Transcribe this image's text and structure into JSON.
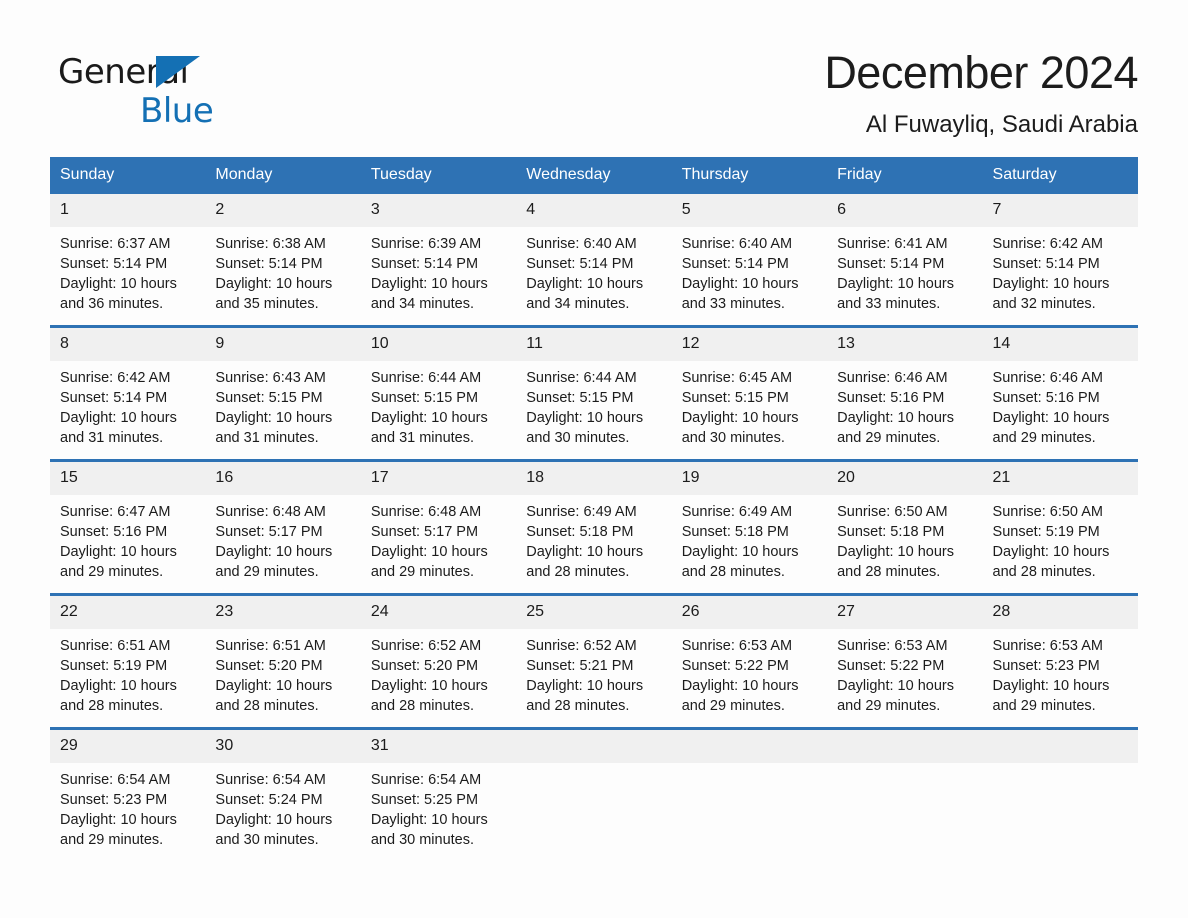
{
  "brand": {
    "name_part1": "General",
    "name_part2": "Blue",
    "flag_icon": "triangle-flag-icon",
    "accent_color": "#1470b4"
  },
  "header": {
    "title": "December 2024",
    "subtitle": "Al Fuwayliq, Saudi Arabia"
  },
  "colors": {
    "header_blue": "#2e72b4",
    "date_band": "#f0f0f0",
    "page_background": "#fdfdfd",
    "text": "#1c1c1c"
  },
  "weekdays": [
    "Sunday",
    "Monday",
    "Tuesday",
    "Wednesday",
    "Thursday",
    "Friday",
    "Saturday"
  ],
  "weeks": [
    [
      {
        "day": "1",
        "sunrise": "Sunrise: 6:37 AM",
        "sunset": "Sunset: 5:14 PM",
        "daylight_line1": "Daylight: 10 hours",
        "daylight_line2": "and 36 minutes."
      },
      {
        "day": "2",
        "sunrise": "Sunrise: 6:38 AM",
        "sunset": "Sunset: 5:14 PM",
        "daylight_line1": "Daylight: 10 hours",
        "daylight_line2": "and 35 minutes."
      },
      {
        "day": "3",
        "sunrise": "Sunrise: 6:39 AM",
        "sunset": "Sunset: 5:14 PM",
        "daylight_line1": "Daylight: 10 hours",
        "daylight_line2": "and 34 minutes."
      },
      {
        "day": "4",
        "sunrise": "Sunrise: 6:40 AM",
        "sunset": "Sunset: 5:14 PM",
        "daylight_line1": "Daylight: 10 hours",
        "daylight_line2": "and 34 minutes."
      },
      {
        "day": "5",
        "sunrise": "Sunrise: 6:40 AM",
        "sunset": "Sunset: 5:14 PM",
        "daylight_line1": "Daylight: 10 hours",
        "daylight_line2": "and 33 minutes."
      },
      {
        "day": "6",
        "sunrise": "Sunrise: 6:41 AM",
        "sunset": "Sunset: 5:14 PM",
        "daylight_line1": "Daylight: 10 hours",
        "daylight_line2": "and 33 minutes."
      },
      {
        "day": "7",
        "sunrise": "Sunrise: 6:42 AM",
        "sunset": "Sunset: 5:14 PM",
        "daylight_line1": "Daylight: 10 hours",
        "daylight_line2": "and 32 minutes."
      }
    ],
    [
      {
        "day": "8",
        "sunrise": "Sunrise: 6:42 AM",
        "sunset": "Sunset: 5:14 PM",
        "daylight_line1": "Daylight: 10 hours",
        "daylight_line2": "and 31 minutes."
      },
      {
        "day": "9",
        "sunrise": "Sunrise: 6:43 AM",
        "sunset": "Sunset: 5:15 PM",
        "daylight_line1": "Daylight: 10 hours",
        "daylight_line2": "and 31 minutes."
      },
      {
        "day": "10",
        "sunrise": "Sunrise: 6:44 AM",
        "sunset": "Sunset: 5:15 PM",
        "daylight_line1": "Daylight: 10 hours",
        "daylight_line2": "and 31 minutes."
      },
      {
        "day": "11",
        "sunrise": "Sunrise: 6:44 AM",
        "sunset": "Sunset: 5:15 PM",
        "daylight_line1": "Daylight: 10 hours",
        "daylight_line2": "and 30 minutes."
      },
      {
        "day": "12",
        "sunrise": "Sunrise: 6:45 AM",
        "sunset": "Sunset: 5:15 PM",
        "daylight_line1": "Daylight: 10 hours",
        "daylight_line2": "and 30 minutes."
      },
      {
        "day": "13",
        "sunrise": "Sunrise: 6:46 AM",
        "sunset": "Sunset: 5:16 PM",
        "daylight_line1": "Daylight: 10 hours",
        "daylight_line2": "and 29 minutes."
      },
      {
        "day": "14",
        "sunrise": "Sunrise: 6:46 AM",
        "sunset": "Sunset: 5:16 PM",
        "daylight_line1": "Daylight: 10 hours",
        "daylight_line2": "and 29 minutes."
      }
    ],
    [
      {
        "day": "15",
        "sunrise": "Sunrise: 6:47 AM",
        "sunset": "Sunset: 5:16 PM",
        "daylight_line1": "Daylight: 10 hours",
        "daylight_line2": "and 29 minutes."
      },
      {
        "day": "16",
        "sunrise": "Sunrise: 6:48 AM",
        "sunset": "Sunset: 5:17 PM",
        "daylight_line1": "Daylight: 10 hours",
        "daylight_line2": "and 29 minutes."
      },
      {
        "day": "17",
        "sunrise": "Sunrise: 6:48 AM",
        "sunset": "Sunset: 5:17 PM",
        "daylight_line1": "Daylight: 10 hours",
        "daylight_line2": "and 29 minutes."
      },
      {
        "day": "18",
        "sunrise": "Sunrise: 6:49 AM",
        "sunset": "Sunset: 5:18 PM",
        "daylight_line1": "Daylight: 10 hours",
        "daylight_line2": "and 28 minutes."
      },
      {
        "day": "19",
        "sunrise": "Sunrise: 6:49 AM",
        "sunset": "Sunset: 5:18 PM",
        "daylight_line1": "Daylight: 10 hours",
        "daylight_line2": "and 28 minutes."
      },
      {
        "day": "20",
        "sunrise": "Sunrise: 6:50 AM",
        "sunset": "Sunset: 5:18 PM",
        "daylight_line1": "Daylight: 10 hours",
        "daylight_line2": "and 28 minutes."
      },
      {
        "day": "21",
        "sunrise": "Sunrise: 6:50 AM",
        "sunset": "Sunset: 5:19 PM",
        "daylight_line1": "Daylight: 10 hours",
        "daylight_line2": "and 28 minutes."
      }
    ],
    [
      {
        "day": "22",
        "sunrise": "Sunrise: 6:51 AM",
        "sunset": "Sunset: 5:19 PM",
        "daylight_line1": "Daylight: 10 hours",
        "daylight_line2": "and 28 minutes."
      },
      {
        "day": "23",
        "sunrise": "Sunrise: 6:51 AM",
        "sunset": "Sunset: 5:20 PM",
        "daylight_line1": "Daylight: 10 hours",
        "daylight_line2": "and 28 minutes."
      },
      {
        "day": "24",
        "sunrise": "Sunrise: 6:52 AM",
        "sunset": "Sunset: 5:20 PM",
        "daylight_line1": "Daylight: 10 hours",
        "daylight_line2": "and 28 minutes."
      },
      {
        "day": "25",
        "sunrise": "Sunrise: 6:52 AM",
        "sunset": "Sunset: 5:21 PM",
        "daylight_line1": "Daylight: 10 hours",
        "daylight_line2": "and 28 minutes."
      },
      {
        "day": "26",
        "sunrise": "Sunrise: 6:53 AM",
        "sunset": "Sunset: 5:22 PM",
        "daylight_line1": "Daylight: 10 hours",
        "daylight_line2": "and 29 minutes."
      },
      {
        "day": "27",
        "sunrise": "Sunrise: 6:53 AM",
        "sunset": "Sunset: 5:22 PM",
        "daylight_line1": "Daylight: 10 hours",
        "daylight_line2": "and 29 minutes."
      },
      {
        "day": "28",
        "sunrise": "Sunrise: 6:53 AM",
        "sunset": "Sunset: 5:23 PM",
        "daylight_line1": "Daylight: 10 hours",
        "daylight_line2": "and 29 minutes."
      }
    ],
    [
      {
        "day": "29",
        "sunrise": "Sunrise: 6:54 AM",
        "sunset": "Sunset: 5:23 PM",
        "daylight_line1": "Daylight: 10 hours",
        "daylight_line2": "and 29 minutes."
      },
      {
        "day": "30",
        "sunrise": "Sunrise: 6:54 AM",
        "sunset": "Sunset: 5:24 PM",
        "daylight_line1": "Daylight: 10 hours",
        "daylight_line2": "and 30 minutes."
      },
      {
        "day": "31",
        "sunrise": "Sunrise: 6:54 AM",
        "sunset": "Sunset: 5:25 PM",
        "daylight_line1": "Daylight: 10 hours",
        "daylight_line2": "and 30 minutes."
      },
      {
        "day": "",
        "sunrise": "",
        "sunset": "",
        "daylight_line1": "",
        "daylight_line2": ""
      },
      {
        "day": "",
        "sunrise": "",
        "sunset": "",
        "daylight_line1": "",
        "daylight_line2": ""
      },
      {
        "day": "",
        "sunrise": "",
        "sunset": "",
        "daylight_line1": "",
        "daylight_line2": ""
      },
      {
        "day": "",
        "sunrise": "",
        "sunset": "",
        "daylight_line1": "",
        "daylight_line2": ""
      }
    ]
  ]
}
